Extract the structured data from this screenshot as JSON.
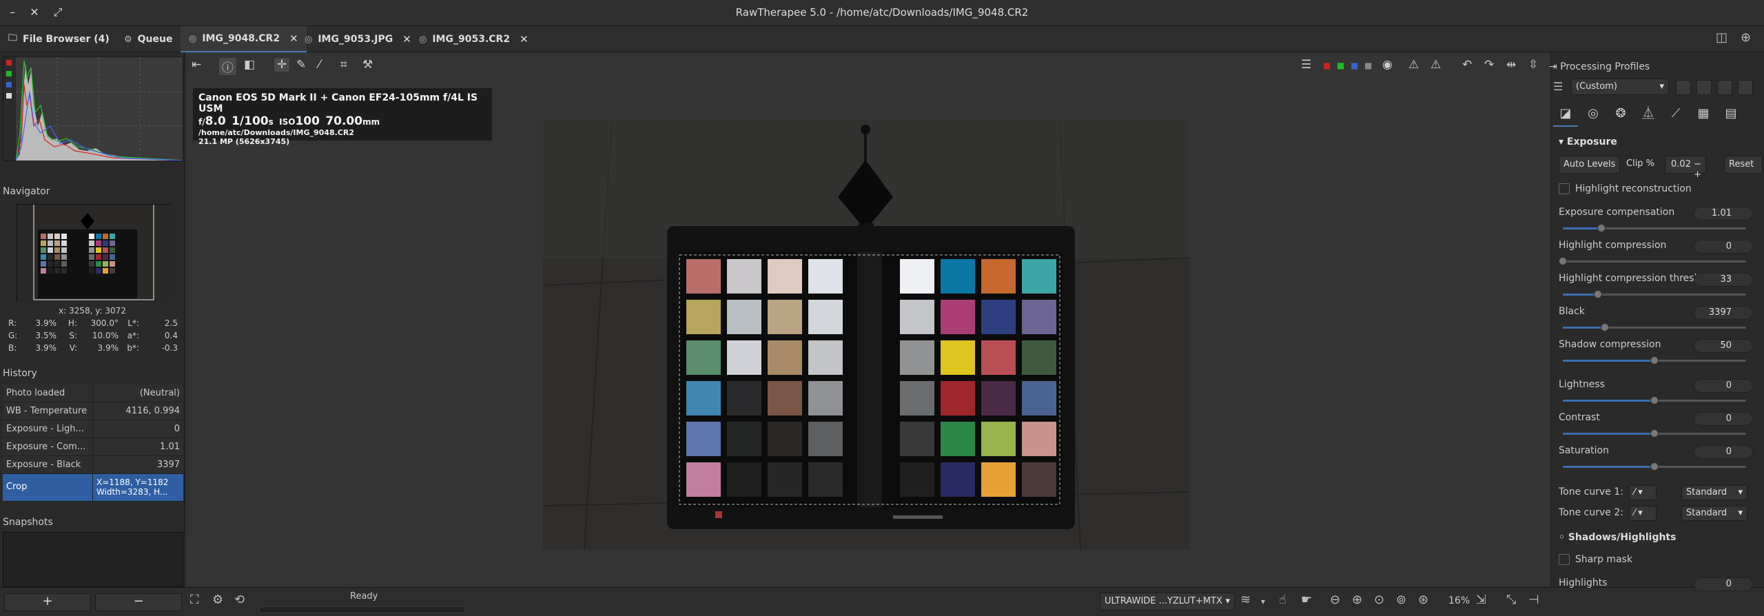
{
  "window": {
    "title": "RawTherapee 5.0 - /home/atc/Downloads/IMG_9048.CR2"
  },
  "tabs": [
    {
      "label": "File Browser (4)"
    },
    {
      "label": "Queue"
    },
    {
      "label": "IMG_9048.CR2"
    },
    {
      "label": "IMG_9053.JPG"
    },
    {
      "label": "IMG_9053.CR2"
    }
  ],
  "left": {
    "navigator_label": "Navigator",
    "coords": "x: 3258, y: 3072",
    "rgb": [
      {
        "k": "R:",
        "v": "3.9%",
        "k2": "H:",
        "v2": "300.0°",
        "k3": "L*:",
        "v3": "2.5"
      },
      {
        "k": "G:",
        "v": "3.5%",
        "k2": "S:",
        "v2": "10.0%",
        "k3": "a*:",
        "v3": "0.4"
      },
      {
        "k": "B:",
        "v": "3.9%",
        "k2": "V:",
        "v2": "3.9%",
        "k3": "b*:",
        "v3": "-0.3"
      }
    ],
    "history_label": "History",
    "history": [
      {
        "action": "Photo loaded",
        "value": "(Neutral)"
      },
      {
        "action": "WB - Temperature",
        "value": "4116, 0.994"
      },
      {
        "action": "Exposure - Ligh...",
        "value": "0"
      },
      {
        "action": "Exposure - Com...",
        "value": "1.01"
      },
      {
        "action": "Exposure - Black",
        "value": "3397"
      },
      {
        "action": "Crop",
        "value": "X=1188, Y=1182",
        "value2": "Width=3283, H..."
      }
    ],
    "snapshots_label": "Snapshots",
    "add_label": "+",
    "remove_label": "−"
  },
  "exif": {
    "camera": "Canon EOS 5D Mark II + Canon EF24-105mm f/4L IS USM",
    "f_prefix": "f/",
    "f": "8.0",
    "shutter": "1/100",
    "shutter_unit": "s",
    "iso_prefix": "ISO",
    "iso": "100",
    "focal": "70.00",
    "focal_unit": "mm",
    "path": "/home/atc/Downloads/IMG_9048.CR2",
    "mp": "21.1 MP (5626x3745)"
  },
  "status": {
    "text": "Ready"
  },
  "bottom": {
    "profile": "ULTRAWIDE ...YZLUT+MTX",
    "zoom": "16%"
  },
  "right": {
    "profiles_label": "Processing Profiles",
    "profile": "(Custom)",
    "exposure_label": "Exposure",
    "auto_levels": "Auto Levels",
    "clip_label": "Clip %",
    "clip_value": "0.02",
    "reset": "Reset",
    "highlight_recon": "Highlight reconstruction",
    "sliders": [
      {
        "label": "Exposure compensation",
        "value": "1.01",
        "pos": 0.21
      },
      {
        "label": "Highlight compression",
        "value": "0",
        "pos": 0
      },
      {
        "label": "Highlight compression threshold",
        "value": "33",
        "pos": 0.19
      },
      {
        "label": "Black",
        "value": "3397",
        "pos": 0.23
      },
      {
        "label": "Shadow compression",
        "value": "50",
        "pos": 0.5
      },
      {
        "label": "Lightness",
        "value": "0",
        "pos": 0.5
      },
      {
        "label": "Contrast",
        "value": "0",
        "pos": 0.5
      },
      {
        "label": "Saturation",
        "value": "0",
        "pos": 0.5
      }
    ],
    "tone1_label": "Tone curve 1:",
    "tone1_value": "Standard",
    "tone2_label": "Tone curve 2:",
    "tone2_value": "Standard",
    "shadows_label": "Shadows/Highlights",
    "sharp_mask": "Sharp mask",
    "highlights_label": "Highlights",
    "highlights_value": "0"
  }
}
